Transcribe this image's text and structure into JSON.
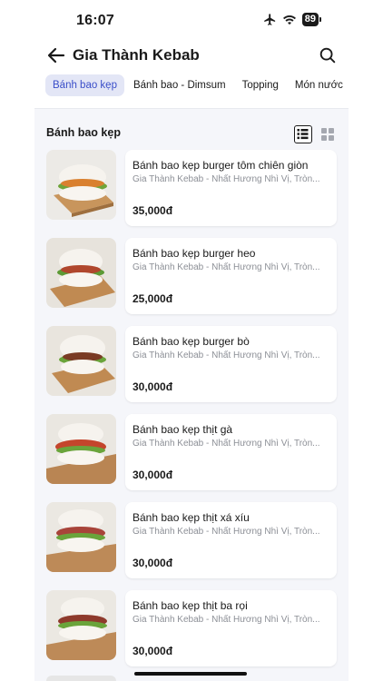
{
  "status_bar": {
    "time": "16:07",
    "battery": "89"
  },
  "header": {
    "title": "Gia Thành Kebab"
  },
  "tabs": [
    {
      "label": "Bánh bao kẹp",
      "active": true
    },
    {
      "label": "Bánh bao - Dimsum",
      "active": false
    },
    {
      "label": "Topping",
      "active": false
    },
    {
      "label": "Món nước",
      "active": false
    }
  ],
  "section": {
    "title": "Bánh bao kẹp"
  },
  "items": [
    {
      "name": "Bánh bao kẹp burger  tôm chiên giòn",
      "shop": "Gia Thành Kebab - Nhất Hương Nhì Vị, Tròn...",
      "price": "35,000đ"
    },
    {
      "name": "Bánh bao kẹp burger heo",
      "shop": "Gia Thành Kebab - Nhất Hương Nhì Vị, Tròn...",
      "price": "25,000đ"
    },
    {
      "name": "Bánh bao kẹp burger bò",
      "shop": "Gia Thành Kebab - Nhất Hương Nhì Vị, Tròn...",
      "price": "30,000đ"
    },
    {
      "name": "Bánh bao kẹp thịt gà",
      "shop": "Gia Thành Kebab - Nhất Hương Nhì Vị, Tròn...",
      "price": "30,000đ"
    },
    {
      "name": "Bánh bao kẹp thịt xá xíu",
      "shop": "Gia Thành Kebab - Nhất Hương Nhì Vị, Tròn...",
      "price": "30,000đ"
    },
    {
      "name": "Bánh bao kẹp thịt ba rọi",
      "shop": "Gia Thành Kebab - Nhất Hương Nhì Vị, Tròn...",
      "price": "30,000đ"
    }
  ],
  "icons": {
    "back": "arrow-left-icon",
    "search": "search-icon",
    "list_view": "list-view-icon",
    "grid_view": "grid-view-icon"
  },
  "colors": {
    "accent": "#3a4ec9",
    "active_tab_bg": "#e3e6f6",
    "content_bg": "#f5f6fa"
  }
}
